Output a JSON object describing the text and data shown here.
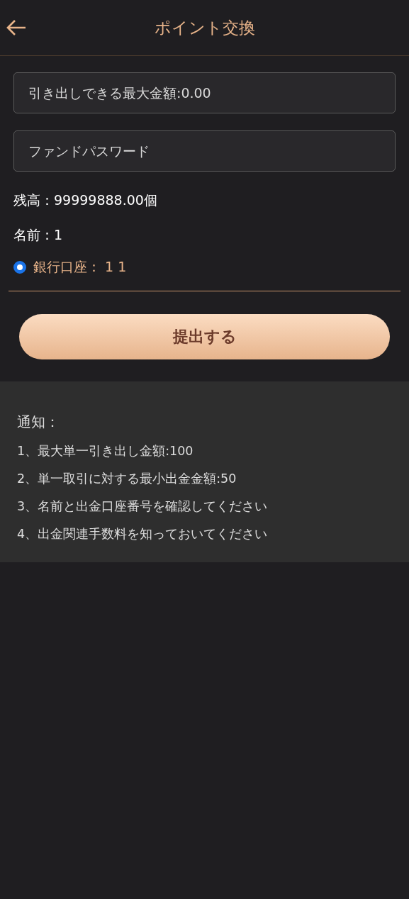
{
  "header": {
    "title": "ポイント交換"
  },
  "fields": [
    {
      "placeholder": "引き出しできる最大金額:0.00"
    },
    {
      "placeholder": "ファンドパスワード"
    }
  ],
  "info": [
    "残高：99999888.00個",
    "名前：1"
  ],
  "accounts": [
    {
      "label": "銀行口座： 1 1",
      "selected": true
    }
  ],
  "submit": "提出する",
  "notice": {
    "title": "通知：",
    "items": [
      "1、最大単一引き出し金額:100",
      "2、単一取引に対する最小出金金額:50",
      "3、名前と出金口座番号を確認してください",
      "4、出金関連手数料を知っておいてください"
    ]
  }
}
